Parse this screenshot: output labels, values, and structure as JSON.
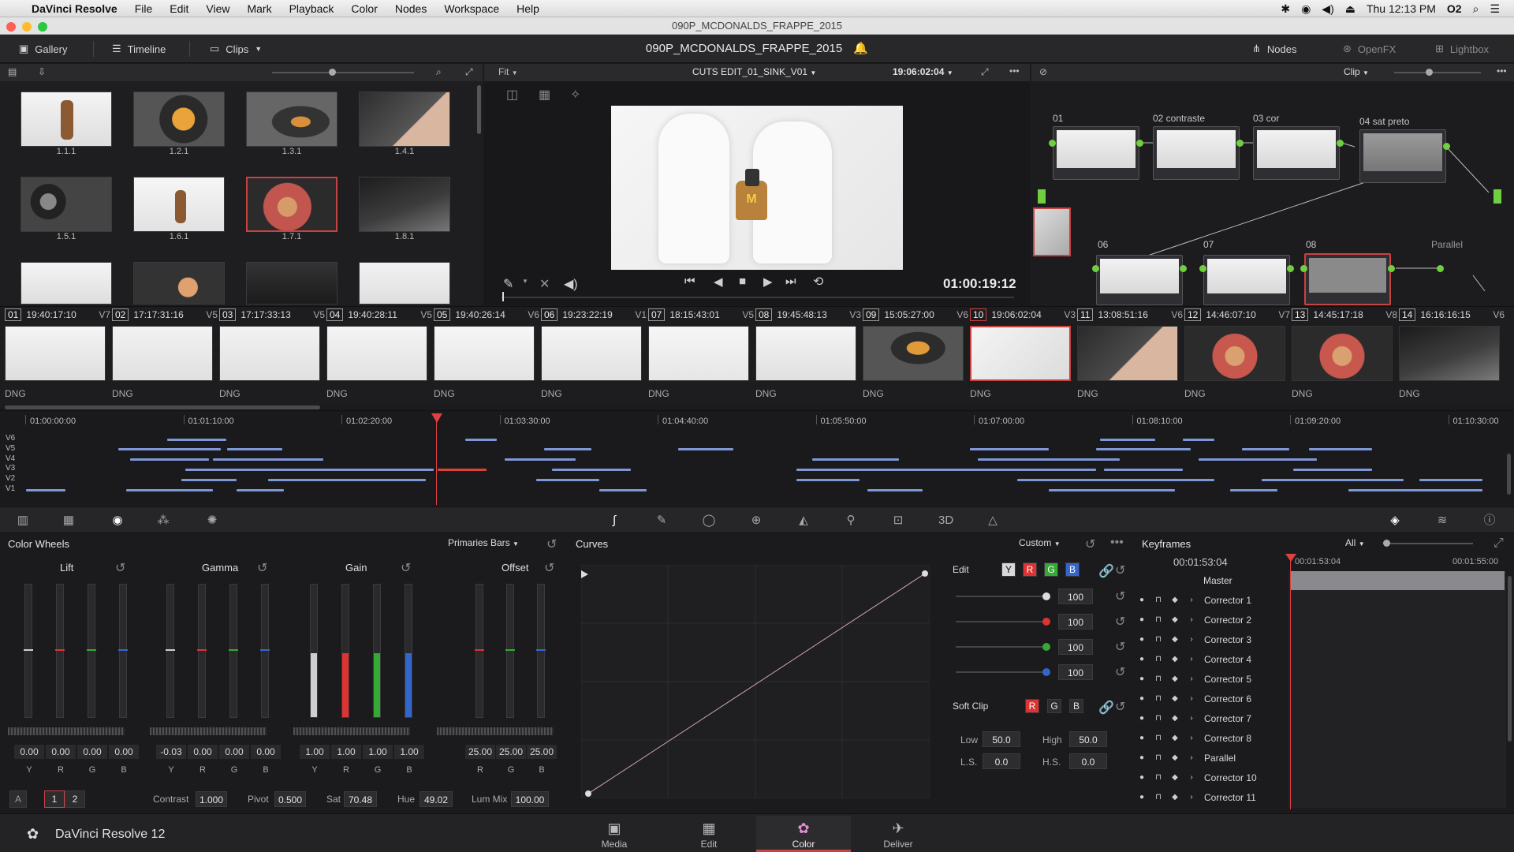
{
  "menubar": {
    "app_name": "DaVinci Resolve",
    "items": [
      "File",
      "Edit",
      "View",
      "Mark",
      "Playback",
      "Color",
      "Nodes",
      "Workspace",
      "Help"
    ],
    "clock": "Thu 12:13 PM",
    "user": "O2"
  },
  "window": {
    "title": "090P_MCDONALDS_FRAPPE_2015"
  },
  "toolbar": {
    "gallery": "Gallery",
    "timeline": "Timeline",
    "clips": "Clips",
    "project_title": "090P_MCDONALDS_FRAPPE_2015",
    "nodes": "Nodes",
    "openfx": "OpenFX",
    "lightbox": "Lightbox"
  },
  "viewer": {
    "zoom": "Fit",
    "timeline_name": "CUTS EDIT_01_SINK_V01",
    "source_tc": "19:06:02:04",
    "record_tc": "01:00:19:12"
  },
  "nodes_panel": {
    "mode": "Clip",
    "nodes": [
      {
        "id": "01",
        "label": "01"
      },
      {
        "id": "02",
        "label": "02 contraste"
      },
      {
        "id": "03",
        "label": "03 cor"
      },
      {
        "id": "04",
        "label": "04 sat preto"
      },
      {
        "id": "06",
        "label": "06"
      },
      {
        "id": "07",
        "label": "07"
      },
      {
        "id": "08",
        "label": "08"
      }
    ],
    "parallel": "Parallel"
  },
  "gallery": {
    "stills": [
      "1.1.1",
      "1.2.1",
      "1.3.1",
      "1.4.1",
      "1.5.1",
      "1.6.1",
      "1.7.1",
      "1.8.1"
    ]
  },
  "clips": [
    {
      "num": "01",
      "tc": "19:40:17:10",
      "track": "V7",
      "codec": "DNG"
    },
    {
      "num": "02",
      "tc": "17:17:31:16",
      "track": "V5",
      "codec": "DNG"
    },
    {
      "num": "03",
      "tc": "17:17:33:13",
      "track": "V5",
      "codec": "DNG"
    },
    {
      "num": "04",
      "tc": "19:40:28:11",
      "track": "V5",
      "codec": "DNG"
    },
    {
      "num": "05",
      "tc": "19:40:26:14",
      "track": "V6",
      "codec": "DNG"
    },
    {
      "num": "06",
      "tc": "19:23:22:19",
      "track": "V1",
      "codec": "DNG"
    },
    {
      "num": "07",
      "tc": "18:15:43:01",
      "track": "V5",
      "codec": "DNG"
    },
    {
      "num": "08",
      "tc": "19:45:48:13",
      "track": "V3",
      "codec": "DNG"
    },
    {
      "num": "09",
      "tc": "15:05:27:00",
      "track": "V6",
      "codec": "DNG"
    },
    {
      "num": "10",
      "tc": "19:06:02:04",
      "track": "V3",
      "codec": "DNG"
    },
    {
      "num": "11",
      "tc": "13:08:51:16",
      "track": "V6",
      "codec": "DNG"
    },
    {
      "num": "12",
      "tc": "14:46:07:10",
      "track": "V7",
      "codec": "DNG"
    },
    {
      "num": "13",
      "tc": "14:45:17:18",
      "track": "V8",
      "codec": "DNG"
    },
    {
      "num": "14",
      "tc": "16:16:16:15",
      "track": "V6",
      "codec": "DNG"
    }
  ],
  "mini_timeline": {
    "ruler": [
      "01:00:00:00",
      "01:01:10:00",
      "01:02:20:00",
      "01:03:30:00",
      "01:04:40:00",
      "01:05:50:00",
      "01:07:00:00",
      "01:08:10:00",
      "01:09:20:00",
      "01:10:30:00"
    ],
    "tracks": [
      "V6",
      "V5",
      "V4",
      "V3",
      "V2",
      "V1"
    ]
  },
  "color_wheels": {
    "title": "Color Wheels",
    "mode": "Primaries Bars",
    "groups": [
      {
        "name": "Lift",
        "values": [
          "0.00",
          "0.00",
          "0.00",
          "0.00"
        ],
        "channels": [
          "Y",
          "R",
          "G",
          "B"
        ],
        "bars": [
          0,
          0,
          0,
          0
        ]
      },
      {
        "name": "Gamma",
        "values": [
          "-0.03",
          "0.00",
          "0.00",
          "0.00"
        ],
        "channels": [
          "Y",
          "R",
          "G",
          "B"
        ],
        "bars": [
          0,
          0,
          0,
          0
        ]
      },
      {
        "name": "Gain",
        "values": [
          "1.00",
          "1.00",
          "1.00",
          "1.00"
        ],
        "channels": [
          "Y",
          "R",
          "G",
          "B"
        ],
        "bars": [
          0.48,
          0.48,
          0.48,
          0.48
        ]
      },
      {
        "name": "Offset",
        "values": [
          "25.00",
          "25.00",
          "25.00"
        ],
        "channels": [
          "R",
          "G",
          "B"
        ],
        "bars": [
          0,
          0,
          0
        ]
      }
    ],
    "footer": {
      "a": "A",
      "page1": "1",
      "page2": "2",
      "contrast_label": "Contrast",
      "contrast": "1.000",
      "pivot_label": "Pivot",
      "pivot": "0.500",
      "sat_label": "Sat",
      "sat": "70.48",
      "hue_label": "Hue",
      "hue": "49.02",
      "lummix_label": "Lum Mix",
      "lummix": "100.00"
    }
  },
  "curves": {
    "title": "Curves",
    "mode": "Custom",
    "edit_label": "Edit",
    "channels": [
      "Y",
      "R",
      "G",
      "B"
    ],
    "intensities": [
      "100",
      "100",
      "100",
      "100"
    ],
    "softclip_label": "Soft Clip",
    "softclip_channels": [
      "R",
      "G",
      "B"
    ],
    "low_label": "Low",
    "low": "50.0",
    "high_label": "High",
    "high": "50.0",
    "ls_label": "L.S.",
    "ls": "0.0",
    "hs_label": "H.S.",
    "hs": "0.0"
  },
  "keyframes": {
    "title": "Keyframes",
    "filter": "All",
    "tc_current": "00:01:53:04",
    "tc_ruler_start": "00:01:53:04",
    "tc_ruler_end": "00:01:55:00",
    "master": "Master",
    "rows": [
      "Corrector 1",
      "Corrector 2",
      "Corrector 3",
      "Corrector 4",
      "Corrector 5",
      "Corrector 6",
      "Corrector 7",
      "Corrector 8",
      "Parallel",
      "Corrector 10",
      "Corrector 11"
    ]
  },
  "pages": {
    "brand": "DaVinci Resolve 12",
    "items": [
      {
        "label": "Media",
        "icon": "media-icon"
      },
      {
        "label": "Edit",
        "icon": "edit-icon"
      },
      {
        "label": "Color",
        "icon": "color-icon",
        "active": true
      },
      {
        "label": "Deliver",
        "icon": "deliver-icon"
      }
    ]
  },
  "colors": {
    "accent_red": "#c94242",
    "node_green": "#6fcf3f",
    "clip_blue": "#7e97d6",
    "playhead": "#e04040"
  }
}
